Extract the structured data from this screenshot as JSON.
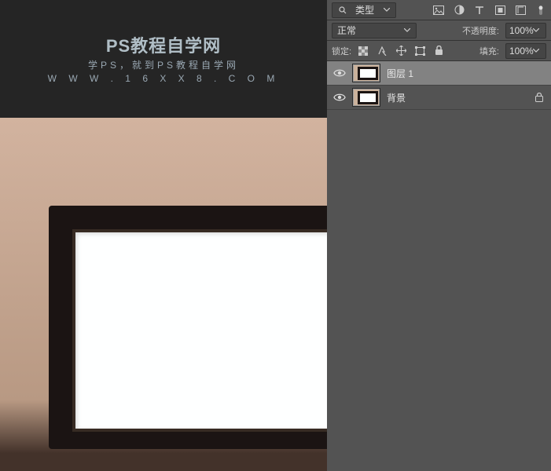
{
  "canvas": {
    "watermark_title": "PS教程自学网",
    "watermark_sub": "学PS，就到PS教程自学网",
    "watermark_url": "W W W . 1 6 X X 8 . C O M"
  },
  "panel": {
    "filter": {
      "label": "类型",
      "icons": {
        "image": "image-filter-icon",
        "contrast": "contrast-filter-icon",
        "text": "text-filter-icon",
        "shape": "shape-filter-icon",
        "smart": "smart-filter-icon",
        "toggle": "toggle-icon"
      }
    },
    "blend": {
      "mode": "正常",
      "opacity_label": "不透明度:",
      "opacity_value": "100%"
    },
    "lock": {
      "label": "锁定:",
      "fill_label": "填充:",
      "fill_value": "100%"
    },
    "layers": [
      {
        "name": "图层 1",
        "locked": false,
        "selected": true
      },
      {
        "name": "背景",
        "locked": true,
        "selected": false
      }
    ]
  }
}
